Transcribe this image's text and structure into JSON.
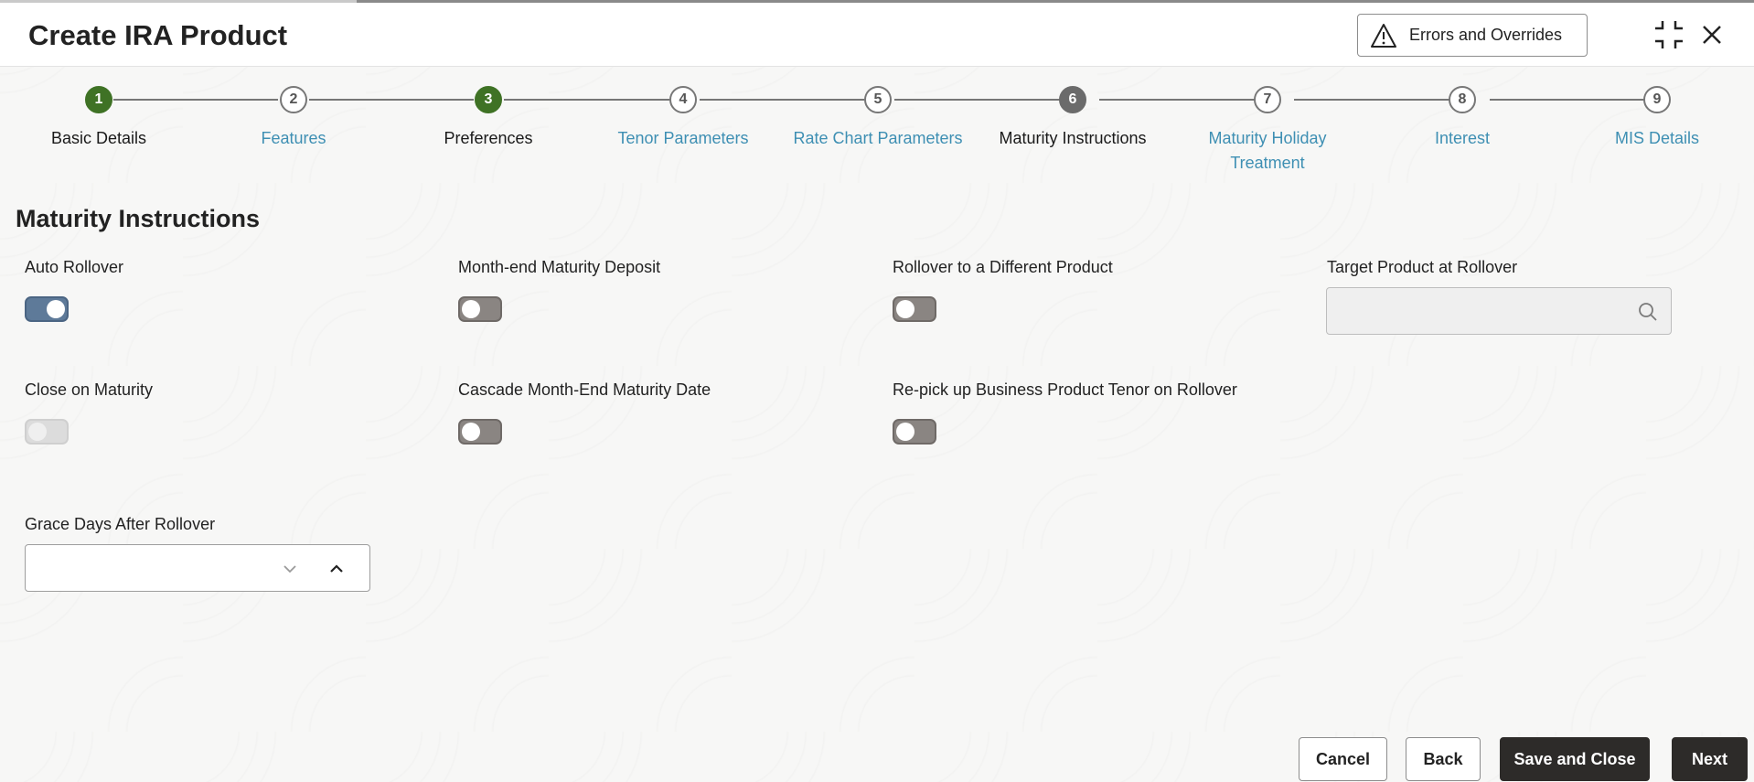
{
  "header": {
    "title": "Create IRA Product",
    "errors_button": "Errors and Overrides",
    "icons": {
      "warning": "warning-icon",
      "compress": "compress-icon",
      "close": "close-icon"
    }
  },
  "stepper": {
    "steps": [
      {
        "number": "1",
        "label": "Basic Details",
        "state": "done"
      },
      {
        "number": "2",
        "label": "Features",
        "state": "pending"
      },
      {
        "number": "3",
        "label": "Preferences",
        "state": "done"
      },
      {
        "number": "4",
        "label": "Tenor Parameters",
        "state": "pending"
      },
      {
        "number": "5",
        "label": "Rate Chart Parameters",
        "state": "pending"
      },
      {
        "number": "6",
        "label": "Maturity Instructions",
        "state": "current"
      },
      {
        "number": "7",
        "label": "Maturity Holiday Treatment",
        "state": "pending"
      },
      {
        "number": "8",
        "label": "Interest",
        "state": "pending"
      },
      {
        "number": "9",
        "label": "MIS Details",
        "state": "pending"
      }
    ]
  },
  "section": {
    "title": "Maturity Instructions",
    "auto_rollover": {
      "label": "Auto Rollover",
      "on": true
    },
    "month_end_maturity_deposit": {
      "label": "Month-end Maturity Deposit",
      "on": false
    },
    "rollover_different_product": {
      "label": "Rollover to a Different Product",
      "on": false
    },
    "target_product": {
      "label": "Target Product at Rollover",
      "value": ""
    },
    "close_on_maturity": {
      "label": "Close on Maturity",
      "on": false,
      "disabled": true
    },
    "cascade_month_end": {
      "label": "Cascade Month-End Maturity Date",
      "on": false
    },
    "repick_tenor": {
      "label": "Re-pick up Business Product Tenor on Rollover",
      "on": false
    },
    "grace_days": {
      "label": "Grace Days After Rollover",
      "value": ""
    }
  },
  "footer": {
    "cancel": "Cancel",
    "back": "Back",
    "save_close": "Save and Close",
    "next": "Next"
  },
  "colors": {
    "step_done": "#3f7225",
    "step_current": "#6b6b6b",
    "link_blue": "#3e8fb3",
    "toggle_on": "#5e7a99",
    "primary_button": "#2d2b29"
  }
}
